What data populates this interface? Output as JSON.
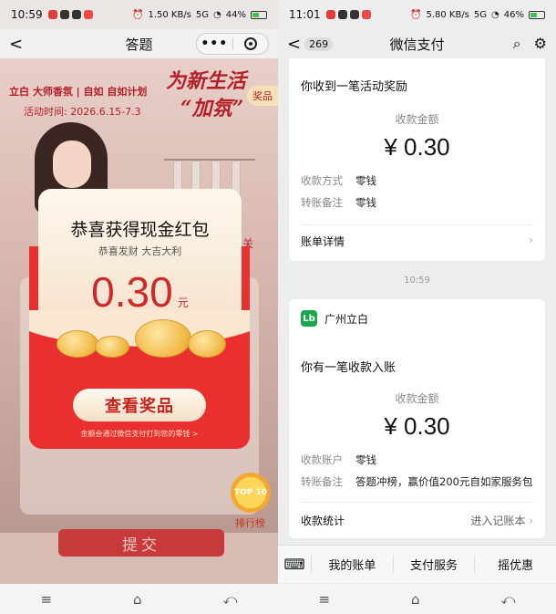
{
  "left": {
    "status": {
      "time": "10:59",
      "speed": "1.50 KB/s",
      "network": "5G",
      "battery": "44%"
    },
    "nav": {
      "back": "<",
      "title": "答题",
      "more": "•••"
    },
    "banner": {
      "brand_a": "立白",
      "brand_b": "大师香氛",
      "brand_c": "自如",
      "brand_d": "自如计划",
      "activity_time": "活动时间: 2026.6.15-7.3",
      "slogan_1": "为新生活",
      "slogan_2": "“加氛”",
      "prize_tag": "奖品",
      "side_text": "关"
    },
    "packet": {
      "title": "恭喜获得现金红包",
      "subtitle": "恭喜发财 大吉大利",
      "amount": "0.30",
      "unit": "元",
      "button": "查看奖品",
      "notice": "金额会通过微信支付打到您的零钱 >"
    },
    "rank": {
      "badge": "TOP 10",
      "label": "排行榜"
    },
    "submit": "提交"
  },
  "right": {
    "status": {
      "time": "11:01",
      "speed": "5.80 KB/s",
      "network": "5G",
      "battery": "46%"
    },
    "nav": {
      "back": "<",
      "unread": "269",
      "title": "微信支付"
    },
    "card1": {
      "heading": "你收到一笔活动奖励",
      "label": "收款金额",
      "amount": "¥ 0.30",
      "row1_key": "收款方式",
      "row1_val": "零钱",
      "row2_key": "转账备注",
      "row2_val": "零钱",
      "footer": "账单详情"
    },
    "timestamp": "10:59",
    "card2": {
      "merchant_logo": "Lb",
      "merchant": "广州立白",
      "heading": "你有一笔收款入账",
      "label": "收款金额",
      "amount": "¥ 0.30",
      "row1_key": "收款账户",
      "row1_val": "零钱",
      "row2_key": "转账备注",
      "row2_val": "答题冲榜，赢价值200元自如家服务包",
      "footer": "收款统计",
      "footer_action": "进入记账本"
    },
    "menu": [
      "我的账单",
      "支付服务",
      "摇优惠"
    ]
  },
  "sysnav": {
    "menu": "≡",
    "home": "⌂",
    "back": "⤺"
  },
  "colors": {
    "red": "#e9302e",
    "wechat_green": "#19a64d",
    "gold": "#f0b842"
  }
}
